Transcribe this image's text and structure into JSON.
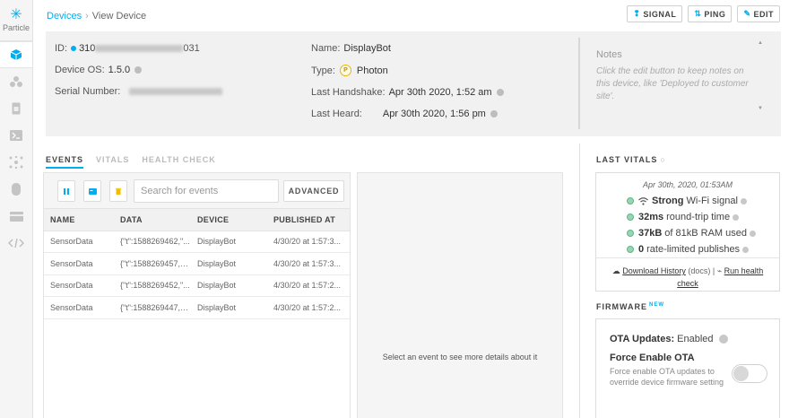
{
  "brand": {
    "name": "Particle"
  },
  "breadcrumb": {
    "parent": "Devices",
    "separator": "›",
    "current": "View Device"
  },
  "actions": {
    "signal": "SIGNAL",
    "ping": "PING",
    "edit": "EDIT"
  },
  "device": {
    "id_prefix": "ID:",
    "id_start": "310",
    "id_end": "031",
    "os_label": "Device OS:",
    "os_value": "1.5.0",
    "serial_label": "Serial Number:",
    "name_label": "Name:",
    "name_value": "DisplayBot",
    "type_label": "Type:",
    "type_badge": "P",
    "type_value": "Photon",
    "handshake_label": "Last Handshake:",
    "handshake_value": "Apr 30th 2020, 1:52 am",
    "heard_label": "Last Heard:",
    "heard_value": "Apr 30th 2020, 1:56 pm"
  },
  "notes": {
    "title": "Notes",
    "placeholder": "Click the edit button to keep notes on this device, like 'Deployed to customer site'."
  },
  "tabs": [
    {
      "label": "EVENTS",
      "active": true
    },
    {
      "label": "VITALS",
      "active": false
    },
    {
      "label": "HEALTH CHECK",
      "active": false
    }
  ],
  "events": {
    "search_placeholder": "Search for events",
    "advanced": "ADVANCED",
    "columns": [
      "NAME",
      "DATA",
      "DEVICE",
      "PUBLISHED AT"
    ],
    "rows": [
      {
        "name": "SensorData",
        "data": "{\"t\":1588269462,\"...",
        "device": "DisplayBot",
        "published": "4/30/20 at 1:57:3..."
      },
      {
        "name": "SensorData",
        "data": "{\"t\":1588269457,\"t...",
        "device": "DisplayBot",
        "published": "4/30/20 at 1:57:3..."
      },
      {
        "name": "SensorData",
        "data": "{\"t\":1588269452,\"...",
        "device": "DisplayBot",
        "published": "4/30/20 at 1:57:2..."
      },
      {
        "name": "SensorData",
        "data": "{\"t\":1588269447,\"t...",
        "device": "DisplayBot",
        "published": "4/30/20 at 1:57:2..."
      }
    ],
    "detail_hint": "Select an event to see more details about it"
  },
  "vitals": {
    "title": "LAST VITALS",
    "refresh_icon": "○",
    "date": "Apr 30th, 2020, 01:53AM",
    "signal_bold": "Strong",
    "signal_rest": "Wi-Fi signal",
    "rtt_bold": "32ms",
    "rtt_rest": "round-trip time",
    "ram_bold": "37kB",
    "ram_rest": "of 81kB RAM used",
    "rl_bold": "0",
    "rl_rest": "rate-limited publishes",
    "download": "Download History",
    "docs": "(docs)",
    "run_health": "Run health",
    "check": "check"
  },
  "firmware": {
    "title": "FIRMWARE",
    "new_badge": "NEW",
    "ota_label": "OTA Updates:",
    "ota_value": "Enabled",
    "force_title": "Force Enable OTA",
    "force_desc": "Force enable OTA updates to override device firmware setting"
  }
}
